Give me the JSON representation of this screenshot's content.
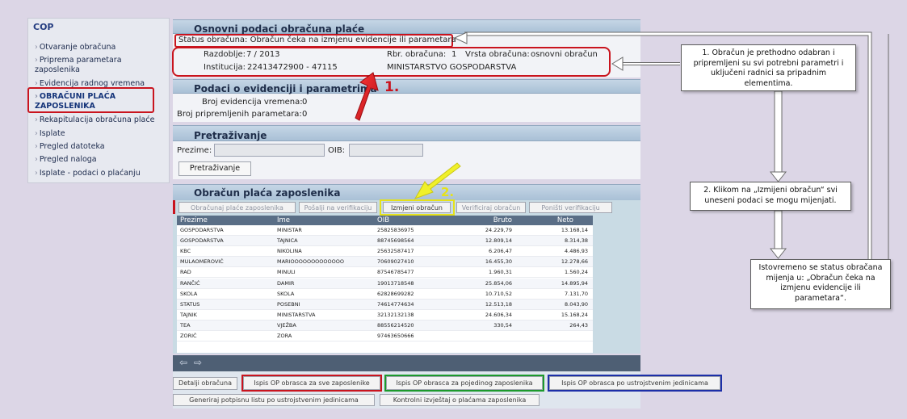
{
  "sidebar": {
    "title": "COP",
    "items": [
      {
        "label": "Otvaranje obračuna"
      },
      {
        "label": "Priprema parametara zaposlenika"
      },
      {
        "label": "Evidencija radnog vremena"
      },
      {
        "label": "OBRAČUNI PLAĆA ZAPOSLENIKA"
      },
      {
        "label": "Rekapitulacija obračuna plaće"
      },
      {
        "label": "Isplate"
      },
      {
        "label": "Pregled datoteka"
      },
      {
        "label": "Pregled naloga"
      },
      {
        "label": "Isplate - podaci o plaćanju"
      }
    ]
  },
  "basic": {
    "header": "Osnovni podaci obračuna plaće",
    "status": "Status obračuna: Obračun čeka na izmjenu evidencije ili parametara",
    "razdoblje_label": "Razdoblje:",
    "razdoblje_value": "7 / 2013",
    "rbr_label": "Rbr. obračuna:",
    "rbr_value": "1",
    "vrsta_label": "Vrsta obračuna:",
    "vrsta_value": "osnovni obračun",
    "institucija_label": "Institucija:",
    "institucija_value": "22413472900 - 47115",
    "institucija_name": "MINISTARSTVO GOSPODARSTVA"
  },
  "evidence": {
    "header": "Podaci o evidenciji i parametrima",
    "evid_label": "Broj evidencija vremena:",
    "evid_value": "0",
    "param_label": "Broj pripremljenih parametara:",
    "param_value": "0"
  },
  "search": {
    "header": "Pretraživanje",
    "prezime_label": "Prezime:",
    "oib_label": "OIB:",
    "button": "Pretraživanje"
  },
  "payroll": {
    "header": "Obračun plaća zaposlenika",
    "buttons": [
      "Obračunaj plaće zaposlenika",
      "Pošalji na verifikaciju",
      "Izmjeni obračun",
      "Verificiraj obračun",
      "Poništi verifikaciju"
    ],
    "columns": [
      "Prezime",
      "Ime",
      "OIB",
      "Bruto",
      "Neto"
    ],
    "rows": [
      [
        "GOSPODARSTVA",
        "MINISTAR",
        "25825836975",
        "24.229,79",
        "13.168,14"
      ],
      [
        "GOSPODARSTVA",
        "TAJNICA",
        "88745698564",
        "12.809,14",
        "8.314,38"
      ],
      [
        "KBC",
        "NIKOLINA",
        "25632587417",
        "6.206,47",
        "4.486,93"
      ],
      [
        "MULAOMEROVIĆ",
        "MARIOOOOOOOOOOOOO",
        "70609027410",
        "16.455,30",
        "12.278,66"
      ],
      [
        "RAD",
        "MINULI",
        "87546785477",
        "1.960,31",
        "1.560,24"
      ],
      [
        "RANČIĆ",
        "DAMIR",
        "19013718548",
        "25.854,06",
        "14.895,94"
      ],
      [
        "SKOLA",
        "SKOLA",
        "62828699282",
        "10.710,52",
        "7.131,70"
      ],
      [
        "STATUS",
        "POSEBNI",
        "74614774634",
        "12.513,18",
        "8.043,90"
      ],
      [
        "TAJNIK",
        "MINISTARSTVA",
        "32132132138",
        "24.606,34",
        "15.168,24"
      ],
      [
        "TEA",
        "VJEŽBA",
        "88556214520",
        "330,54",
        "264,43"
      ],
      [
        "ZORIĆ",
        "ZORA",
        "97463650666",
        "",
        ""
      ]
    ],
    "bottom_buttons": [
      "Detalji obračuna",
      "Ispis OP obrasca za sve zaposlenike",
      "Ispis OP obrasca za pojedinog zaposlenika",
      "Ispis OP obrasca po ustrojstvenim jedinicama",
      "Generiraj potpisnu listu po ustrojstvenim jedinicama",
      "Kontrolni izvještaj o plaćama zaposlenika"
    ]
  },
  "annotations": {
    "marker1": "1.",
    "marker2": "2.",
    "callout1": "1. Obračun je prethodno odabran i pripremljeni su svi potrebni parametri i uključeni radnici sa pripadnim elementima.",
    "callout2": "2. Klikom na „Izmijeni obračun“ svi uneseni podaci se mogu mijenjati.",
    "callout3": "Istovremeno se status obračana mijenja u: „Obračun čeka na izmjenu evidencije ili parametara“."
  },
  "colors": {
    "highlight_red": "#c9141e",
    "highlight_green": "#1c9a2c",
    "highlight_blue": "#1c2fa8",
    "highlight_yellow": "#e6e21a",
    "header_blue": "#a9c0d6"
  }
}
